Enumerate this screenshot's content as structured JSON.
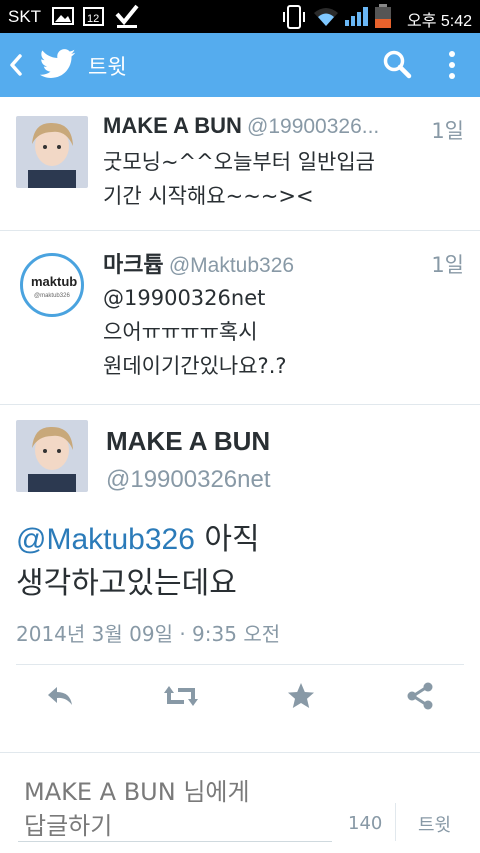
{
  "status_bar": {
    "carrier": "SKT",
    "notification_badge": "12",
    "time": "오후 5:42"
  },
  "action_bar": {
    "title": "트윗",
    "color": "#55acee"
  },
  "tweets": [
    {
      "name": "MAKE A BUN",
      "handle": "@19900326...",
      "age": "1일",
      "lines": [
        "굿모닝~^^오늘부터 일반입금",
        "기간 시작해요~~~><"
      ]
    },
    {
      "name": "마크튭",
      "handle": "@Maktub326",
      "age": "1일",
      "avatar_text": "maktub",
      "avatar_subtext": "@maktub326",
      "lines": [
        "@19900326net",
        "으어ㅠㅠㅠㅠ혹시",
        "원데이기간있나요?.?"
      ]
    }
  ],
  "detail": {
    "name": "MAKE A BUN",
    "handle": "@19900326net",
    "mention": "@Maktub326",
    "line1_rest": " 아직",
    "line2": "생각하고있는데요",
    "timestamp": "2014년 3월 09일 · 9:35 오전"
  },
  "actions": [
    "reply-icon",
    "retweet-icon",
    "favorite-icon",
    "share-icon"
  ],
  "reply_box": {
    "placeholder_line1": "MAKE A BUN 님에게",
    "placeholder_line2": "답글하기",
    "char_count": "140",
    "send_label": "트윗"
  }
}
